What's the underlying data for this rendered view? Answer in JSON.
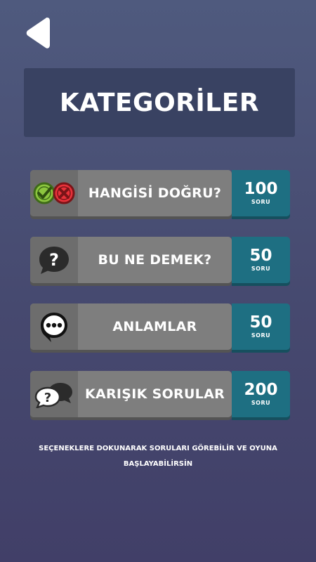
{
  "screen": {
    "title": "KATEGORİLER",
    "hint": "SEÇENEKLERE DOKUNARAK SORULARI GÖREBİLİR VE OYUNA BAŞLAYABİLİRSİN"
  },
  "categories": [
    {
      "label": "HANGİSİ DOĞRU?",
      "count": "100",
      "unit": "SORU",
      "icon": "check-cross-icon"
    },
    {
      "label": "BU NE DEMEK?",
      "count": "50",
      "unit": "SORU",
      "icon": "question-bubble-icon"
    },
    {
      "label": "ANLAMLAR",
      "count": "50",
      "unit": "SORU",
      "icon": "ellipsis-bubble-icon"
    },
    {
      "label": "KARIŞIK SORULAR",
      "count": "200",
      "unit": "SORU",
      "icon": "chat-bubbles-icon"
    }
  ],
  "colors": {
    "background": "#4a4f74",
    "title_card": "#394262",
    "button_gray": "#7e7e7e",
    "count_teal": "#1e6f82"
  }
}
